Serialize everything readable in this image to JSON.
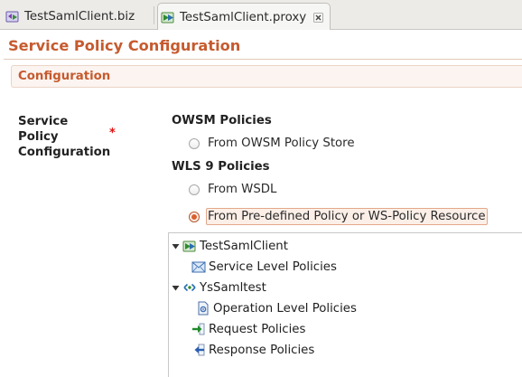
{
  "tabs": [
    {
      "label": "TestSamlClient.biz",
      "active": false,
      "icon": "business-service-icon"
    },
    {
      "label": "TestSamlClient.proxy",
      "active": true,
      "icon": "proxy-service-icon"
    }
  ],
  "page": {
    "title": "Service Policy Configuration"
  },
  "section": {
    "title": "Configuration"
  },
  "field": {
    "label": "Service Policy Configuration",
    "required_marker": "*"
  },
  "owsm": {
    "heading": "OWSM Policies",
    "options": [
      {
        "label": "From OWSM Policy Store",
        "checked": false
      }
    ]
  },
  "wls": {
    "heading": "WLS 9 Policies",
    "options": [
      {
        "label": "From WSDL",
        "checked": false
      },
      {
        "label": "From Pre-defined Policy or WS-Policy Resource",
        "checked": true
      }
    ]
  },
  "tree": {
    "nodes": [
      {
        "label": "TestSamlClient",
        "icon": "proxy-service-icon",
        "expanded": true,
        "children": [
          {
            "label": "Service Level Policies",
            "icon": "envelope-icon"
          }
        ]
      },
      {
        "label": "YsSamltest",
        "icon": "operation-icon",
        "expanded": true,
        "children": [
          {
            "label": "Operation Level Policies",
            "icon": "document-gear-icon"
          },
          {
            "label": "Request Policies",
            "icon": "arrow-right-icon"
          },
          {
            "label": "Response Policies",
            "icon": "arrow-left-icon"
          }
        ]
      }
    ]
  },
  "colors": {
    "accent": "#c65a2e",
    "required": "#e01010",
    "section_bg": "#fbf4f0"
  }
}
